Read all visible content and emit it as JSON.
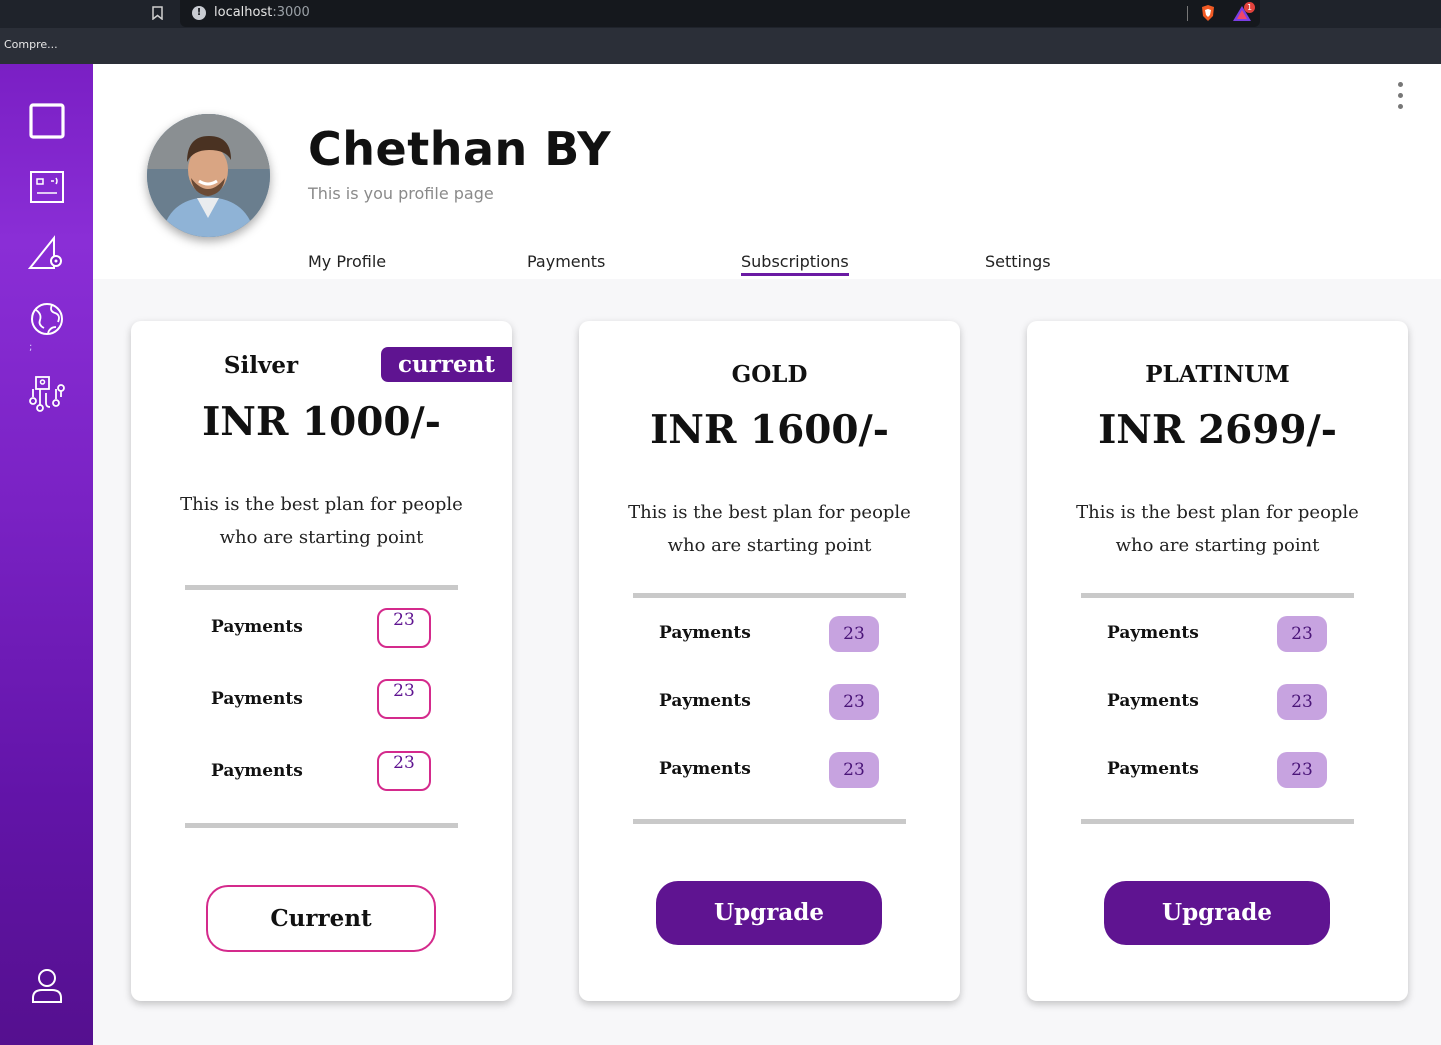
{
  "browser": {
    "url_host": "localhost",
    "url_port": ":3000",
    "tab_title": "Compre...",
    "rewards_badge": "1"
  },
  "sidebar": {
    "icons": [
      "square-icon",
      "dashboard-card-icon",
      "design-tool-icon",
      "globe-icon",
      "user-network-icon"
    ],
    "stray_text": ";",
    "bottom_icon": "user-icon"
  },
  "profile": {
    "name": "Chethan BY",
    "subtitle": "This is you profile page"
  },
  "tabs": [
    {
      "label": "My Profile",
      "active": false
    },
    {
      "label": "Payments",
      "active": false
    },
    {
      "label": "Subscriptions",
      "active": true
    },
    {
      "label": "Settings",
      "active": false
    }
  ],
  "plans": [
    {
      "name": "Silver",
      "badge": "current",
      "price": "INR 1000/-",
      "description": "This is the best plan for people who are starting point",
      "features": [
        {
          "label": "Payments",
          "count": "23"
        },
        {
          "label": "Payments",
          "count": "23"
        },
        {
          "label": "Payments",
          "count": "23"
        }
      ],
      "button": "Current"
    },
    {
      "name": "GOLD",
      "price": "INR 1600/-",
      "description": "This is the best plan for people who are starting point",
      "features": [
        {
          "label": "Payments",
          "count": "23"
        },
        {
          "label": "Payments",
          "count": "23"
        },
        {
          "label": "Payments",
          "count": "23"
        }
      ],
      "button": "Upgrade"
    },
    {
      "name": "PLATINUM",
      "price": "INR 2699/-",
      "description": "This is the best plan for people who are starting point",
      "features": [
        {
          "label": "Payments",
          "count": "23"
        },
        {
          "label": "Payments",
          "count": "23"
        },
        {
          "label": "Payments",
          "count": "23"
        }
      ],
      "button": "Upgrade"
    }
  ],
  "colors": {
    "primary": "#5f1491",
    "accent_pink": "#d42a8c",
    "count_fill": "#c7a3e0"
  }
}
